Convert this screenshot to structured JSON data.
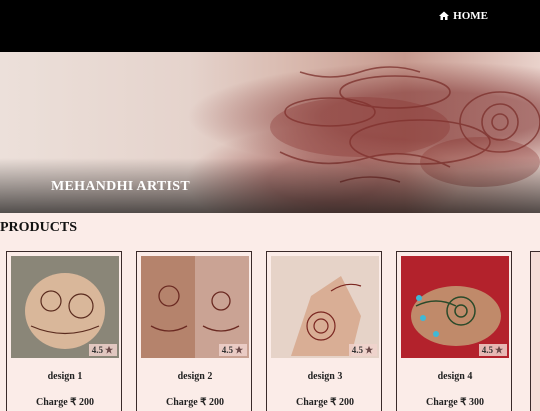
{
  "nav": {
    "home_label": "HOME",
    "home_icon": "home-icon"
  },
  "hero": {
    "title": "MEHANDHI ARTIST"
  },
  "products": {
    "heading": "PRODUCTS",
    "items": [
      {
        "name": "design 1",
        "charge": "Charge ₹ 200",
        "rating": "4.5",
        "rating_icon": "star-icon"
      },
      {
        "name": "design 2",
        "charge": "Charge ₹ 200",
        "rating": "4.5",
        "rating_icon": "star-icon"
      },
      {
        "name": "design 3",
        "charge": "Charge ₹ 200",
        "rating": "4.5",
        "rating_icon": "star-icon"
      },
      {
        "name": "design 4",
        "charge": "Charge ₹ 300",
        "rating": "4.5",
        "rating_icon": "star-icon"
      }
    ]
  },
  "colors": {
    "topbar": "#000000",
    "page_bg": "#fbece8",
    "henna": "#7a2e2a"
  }
}
